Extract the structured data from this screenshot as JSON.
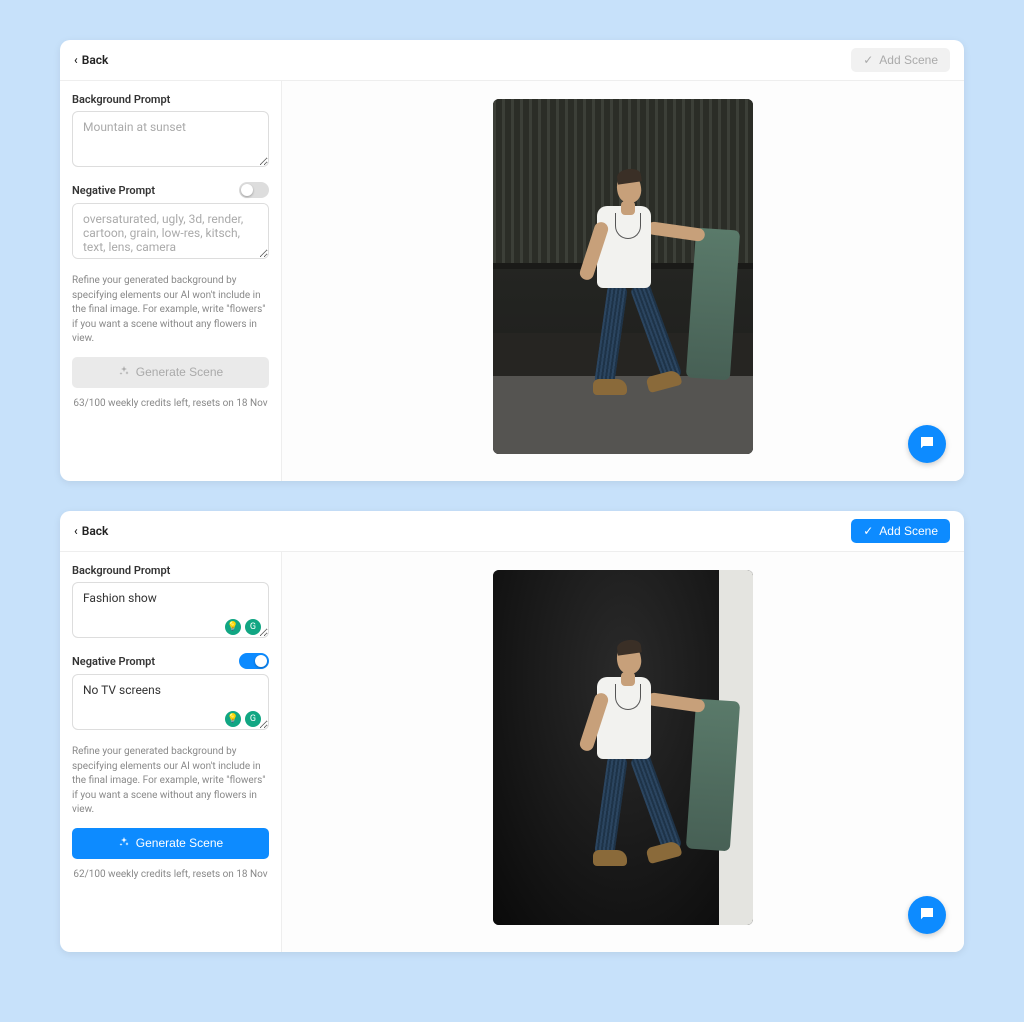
{
  "panels": [
    {
      "back_label": "Back",
      "add_scene_label": "Add Scene",
      "add_scene_enabled": false,
      "bg_prompt_label": "Background Prompt",
      "bg_prompt_placeholder": "Mountain at sunset",
      "bg_prompt_value": "",
      "neg_prompt_label": "Negative Prompt",
      "neg_prompt_toggle_on": false,
      "neg_prompt_placeholder": "oversaturated, ugly, 3d, render, cartoon, grain, low-res, kitsch, text, lens, camera",
      "neg_prompt_value": "",
      "hint": "Refine your generated background by specifying elements our AI won't include in the final image. For example, write \"flowers\" if you want a scene without any flowers in view.",
      "generate_label": "Generate Scene",
      "generate_enabled": false,
      "credits_text": "63/100 weekly credits left, resets on 18 Nov",
      "show_ext_icons": false,
      "scene": "street"
    },
    {
      "back_label": "Back",
      "add_scene_label": "Add Scene",
      "add_scene_enabled": true,
      "bg_prompt_label": "Background Prompt",
      "bg_prompt_placeholder": "",
      "bg_prompt_value": "Fashion show",
      "neg_prompt_label": "Negative Prompt",
      "neg_prompt_toggle_on": true,
      "neg_prompt_placeholder": "",
      "neg_prompt_value": "No TV screens",
      "hint": "Refine your generated background by specifying elements our AI won't include in the final image. For example, write \"flowers\" if you want a scene without any flowers in view.",
      "generate_label": "Generate Scene",
      "generate_enabled": true,
      "credits_text": "62/100 weekly credits left, resets on 18 Nov",
      "show_ext_icons": true,
      "scene": "stage"
    }
  ]
}
